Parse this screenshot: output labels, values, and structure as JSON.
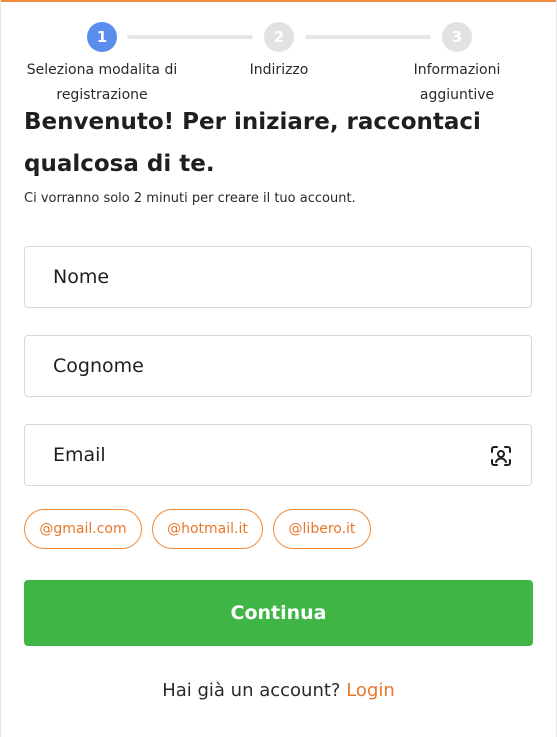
{
  "stepper": {
    "steps": [
      {
        "number": "1",
        "label_line1": "Seleziona modalita di",
        "label_line2": "registrazione"
      },
      {
        "number": "2",
        "label_line1": "Indirizzo",
        "label_line2": ""
      },
      {
        "number": "3",
        "label_line1": "Informazioni",
        "label_line2": "aggiuntive"
      }
    ],
    "active_step": 1
  },
  "header": {
    "title": "Benvenuto! Per iniziare, raccontaci qualcosa di te.",
    "subtitle": "Ci vorranno solo 2 minuti per creare il tuo account."
  },
  "form": {
    "first_name_placeholder": "Nome",
    "last_name_placeholder": "Cognome",
    "email_placeholder": "Email",
    "email_icon": "contact-scan-icon"
  },
  "email_domains": [
    "@gmail.com",
    "@hotmail.it",
    "@libero.it"
  ],
  "actions": {
    "continue_label": "Continua"
  },
  "footer": {
    "prompt": "Hai già un account?",
    "login_label": "Login"
  },
  "colors": {
    "accent_orange": "#e8772a",
    "primary_green": "#3fb545",
    "step_active": "#5b8def",
    "step_inactive": "#e2e2e2"
  }
}
